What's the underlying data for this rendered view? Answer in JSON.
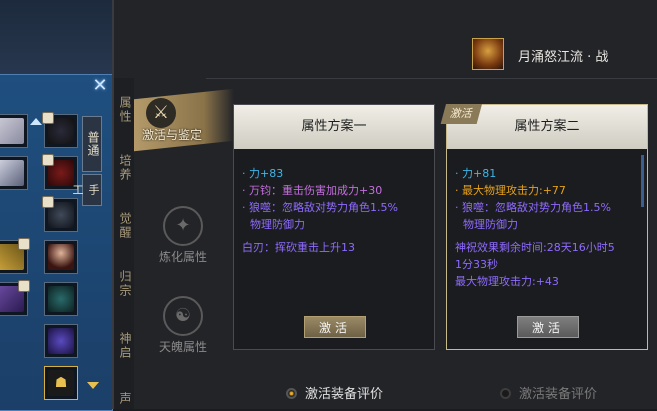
{
  "character": {
    "name": "月涌怒江流 · 战",
    "icon": "character-portrait-icon"
  },
  "nav": {
    "active": "激活与鉴定",
    "items": [
      "炼化属性",
      "天魄属性"
    ]
  },
  "sidebar_tabs": [
    "属性",
    "培养",
    "觉醒",
    "归宗",
    "神启",
    "声"
  ],
  "inventory": {
    "close_label": "✕",
    "tabs": [
      "普通",
      "手工"
    ]
  },
  "schemes": [
    {
      "title": "属性方案一",
      "corner_tag": "",
      "button": "激活",
      "lines": [
        {
          "text": "· 力+83",
          "color": "blue"
        },
        {
          "text": "· 万钧：重击伤害加成力+30",
          "color": "purple"
        },
        {
          "text": "· 狼噬：忽略敌对势力角色1.5%",
          "color": "violet"
        },
        {
          "text": "物理防御力",
          "color": "violet"
        },
        {
          "text": "",
          "color": "gap"
        },
        {
          "text": "白刃：挥砍重击上升13",
          "color": "violet"
        }
      ]
    },
    {
      "title": "属性方案二",
      "corner_tag": "激活",
      "button": "激活",
      "lines": [
        {
          "text": "· 力+81",
          "color": "blue"
        },
        {
          "text": "· 最大物理攻击力:+77",
          "color": "orange"
        },
        {
          "text": "· 狼噬：忽略敌对势力角色1.5%",
          "color": "violet"
        },
        {
          "text": "物理防御力",
          "color": "violet"
        },
        {
          "text": "",
          "color": "gap"
        },
        {
          "text": "神祝效果剩余时间:28天16小时5",
          "color": "violet"
        },
        {
          "text": "1分33秒",
          "color": "violet"
        },
        {
          "text": "最大物理攻击力:+43",
          "color": "violet"
        }
      ]
    }
  ],
  "radios": [
    {
      "label": "激活装备评价",
      "checked": true
    },
    {
      "label": "激活装备评价",
      "checked": false
    }
  ],
  "colors": {
    "blue": "#3fb6e8",
    "purple": "#c56ee0",
    "violet": "#8f6bff",
    "orange": "#e8a21a"
  }
}
